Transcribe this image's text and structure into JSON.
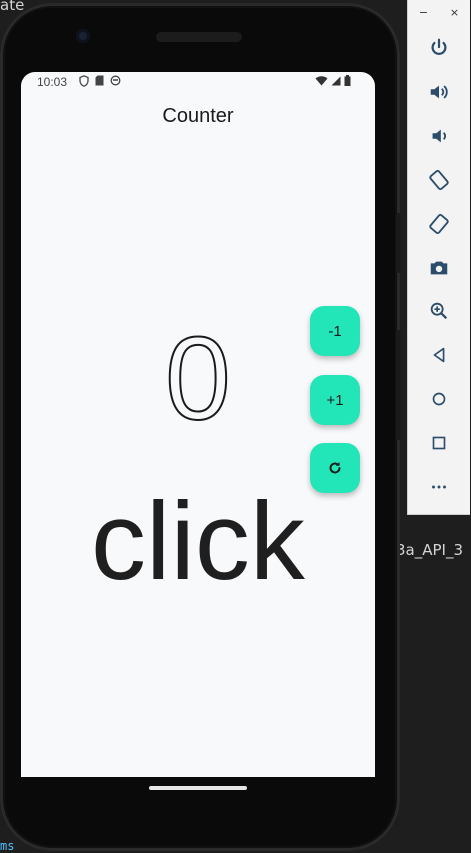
{
  "ide": {
    "top_fragment": "ate",
    "mid_fragment": "3a_API_3",
    "bottom_fragment": "ms"
  },
  "emulator_toolbar": {
    "minimize_label": "−",
    "close_label": "×",
    "buttons": [
      {
        "name": "power-icon"
      },
      {
        "name": "volume-up-icon"
      },
      {
        "name": "volume-down-icon"
      },
      {
        "name": "rotate-left-icon"
      },
      {
        "name": "rotate-right-icon"
      },
      {
        "name": "camera-icon"
      },
      {
        "name": "zoom-icon"
      },
      {
        "name": "back-icon"
      },
      {
        "name": "home-icon"
      },
      {
        "name": "overview-icon"
      },
      {
        "name": "more-icon"
      }
    ]
  },
  "status_bar": {
    "time": "10:03"
  },
  "app": {
    "title": "Counter",
    "counter_value": "0",
    "label": "click",
    "fab_decrement_label": "-1",
    "fab_increment_label": "+1",
    "accent_color": "#22e6b8"
  }
}
